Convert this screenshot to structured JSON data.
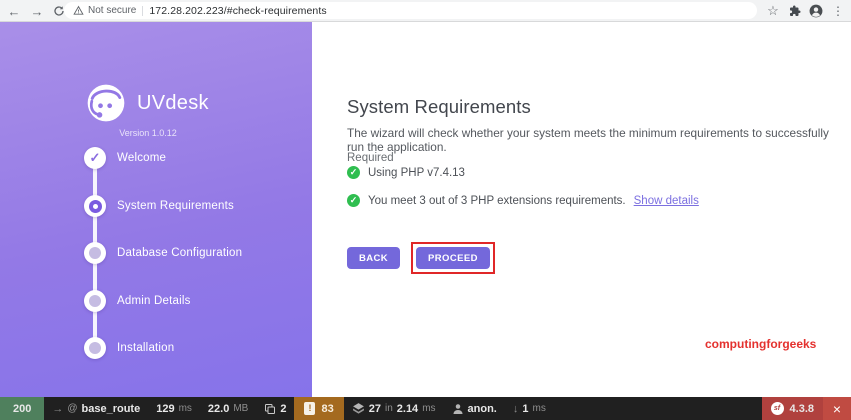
{
  "icons": {
    "check": "✓",
    "back_arrow": "←",
    "forward_arrow": "→",
    "star": "☆",
    "menu_dots": "⋮",
    "route_arrow": "→",
    "route_at": "@",
    "ajax_arrow": "↓",
    "close": "×",
    "sf_mark": "sf",
    "warn_mark": "!"
  },
  "browser": {
    "security_label": "Not secure",
    "url": "172.28.202.223/#check-requirements"
  },
  "sidebar": {
    "brand": "UVdesk",
    "version": "Version 1.0.12",
    "steps": [
      {
        "label": "Welcome",
        "state": "done"
      },
      {
        "label": "System Requirements",
        "state": "current"
      },
      {
        "label": "Database Configuration",
        "state": "pending"
      },
      {
        "label": "Admin Details",
        "state": "pending"
      },
      {
        "label": "Installation",
        "state": "pending"
      }
    ]
  },
  "main": {
    "title": "System Requirements",
    "description": "The wizard will check whether your system meets the minimum requirements to successfully run the application.",
    "required_label": "Required",
    "checks": [
      {
        "text": "Using PHP v7.4.13"
      },
      {
        "text": "You meet 3 out of 3 PHP extensions requirements.",
        "link": "Show details"
      }
    ],
    "buttons": {
      "back": "BACK",
      "proceed": "PROCEED"
    },
    "watermark": "computingforgeeks"
  },
  "profiler": {
    "status": "200",
    "route": "base_route",
    "time": {
      "value": "129",
      "unit": "ms"
    },
    "memory": {
      "value": "22.0",
      "unit": "MB"
    },
    "templates": {
      "count": "2"
    },
    "logs": {
      "count": "83"
    },
    "db": {
      "count": "27",
      "sep": "in",
      "value": "2.14",
      "unit": "ms"
    },
    "user": "anon.",
    "ajax": {
      "value": "1",
      "unit": "ms"
    },
    "symfony_version": "4.3.8"
  },
  "colors": {
    "accent": "#7468db",
    "sidebar_top": "#a98fe8",
    "sidebar_bottom": "#8673ea",
    "success": "#2fbe50",
    "annotation_red": "#e02728",
    "watermark_red": "#e4312e",
    "profiler_ok": "#4f805d",
    "profiler_warn": "#a46a1f",
    "profiler_brand": "#b0413e"
  }
}
